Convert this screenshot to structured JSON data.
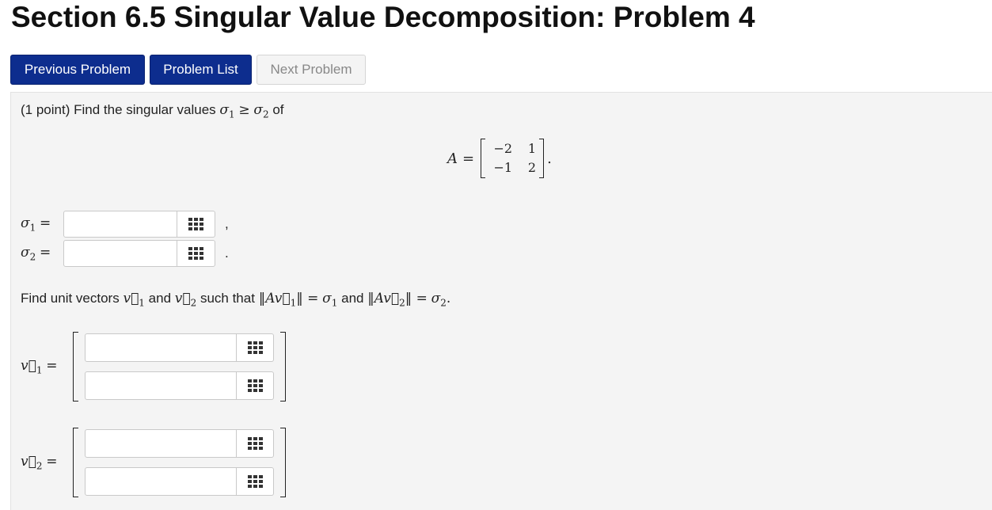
{
  "page": {
    "title": "Section 6.5 Singular Value Decomposition: Problem 4"
  },
  "nav": {
    "previous": "Previous Problem",
    "list": "Problem List",
    "next": "Next Problem"
  },
  "problem": {
    "points": "(1 point)",
    "intro_text": "Find the singular values",
    "sigma1": "σ",
    "sigma2": "σ",
    "sub1": "1",
    "sub2": "2",
    "geq": "≥",
    "of": "of",
    "matrix_label": "A",
    "equals": "=",
    "matrix": [
      [
        "−2",
        "1"
      ],
      [
        "−1",
        "2"
      ]
    ],
    "period": "."
  },
  "answers": {
    "sigma1_value": "",
    "sigma2_value": "",
    "sigma1_punct": ",",
    "sigma2_punct": "."
  },
  "instruction": {
    "text_1": "Find unit vectors",
    "text_and": "and",
    "text_such": "such that",
    "v": "v",
    "norm": "‖",
    "A": "A"
  },
  "vectors": {
    "v1": [
      "",
      ""
    ],
    "v2": [
      "",
      ""
    ]
  }
}
